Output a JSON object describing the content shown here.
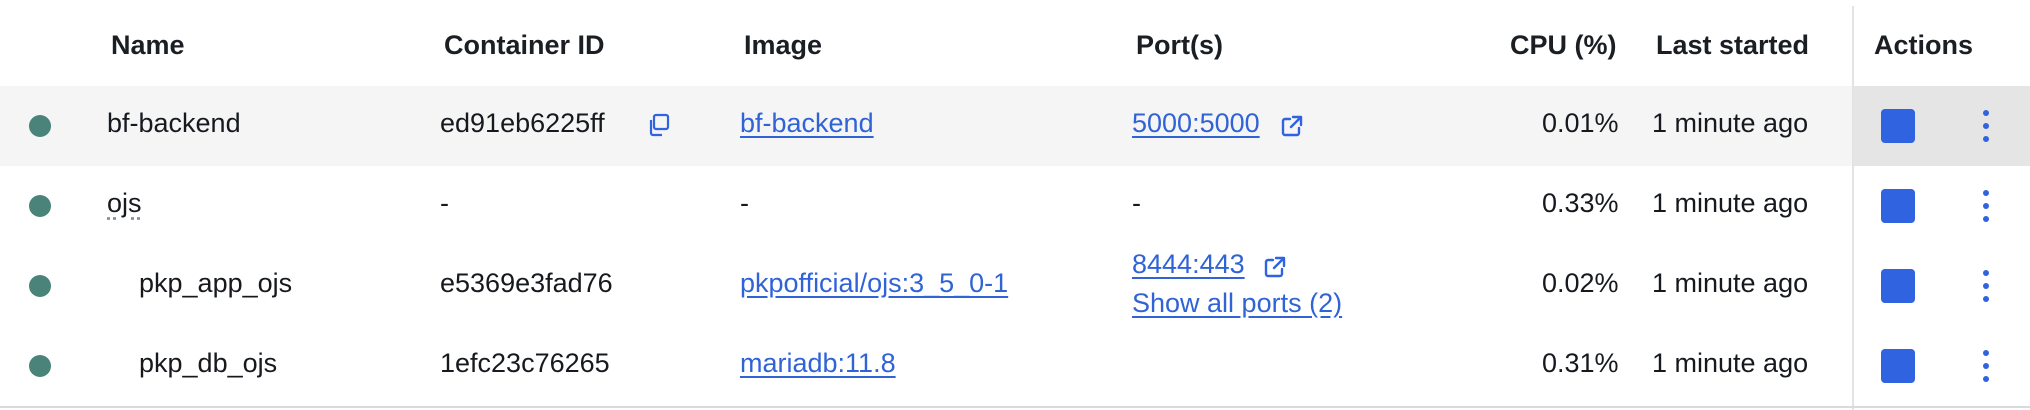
{
  "headers": {
    "name": "Name",
    "container_id": "Container ID",
    "image": "Image",
    "ports": "Port(s)",
    "cpu": "CPU (%)",
    "last_started": "Last started",
    "actions": "Actions"
  },
  "rows": [
    {
      "name": "bf-backend",
      "container_id": "ed91eb6225ff",
      "image": "bf-backend",
      "port": "5000:5000",
      "cpu": "0.01%",
      "last_started": "1 minute ago",
      "status": "running"
    },
    {
      "name": "ojs",
      "container_id": "-",
      "image": "-",
      "port": "-",
      "cpu": "0.33%",
      "last_started": "1 minute ago",
      "status": "running"
    },
    {
      "name": "pkp_app_ojs",
      "container_id": "e5369e3fad76",
      "image": "pkpofficial/ojs:3_5_0-1",
      "port": "8444:443",
      "ports_more": "Show all ports (2)",
      "cpu": "0.02%",
      "last_started": "1 minute ago",
      "status": "running"
    },
    {
      "name": "pkp_db_ojs",
      "container_id": "1efc23c76265",
      "image": "mariadb:11.8",
      "cpu": "0.31%",
      "last_started": "1 minute ago",
      "status": "running"
    }
  ],
  "icons": {
    "copy": "copy-icon",
    "external": "external-link-icon",
    "stop": "stop-icon",
    "more": "more-vertical-icon"
  },
  "colors": {
    "running": "#4a8379",
    "accent": "#2f63e0",
    "link": "#2f63d6"
  }
}
